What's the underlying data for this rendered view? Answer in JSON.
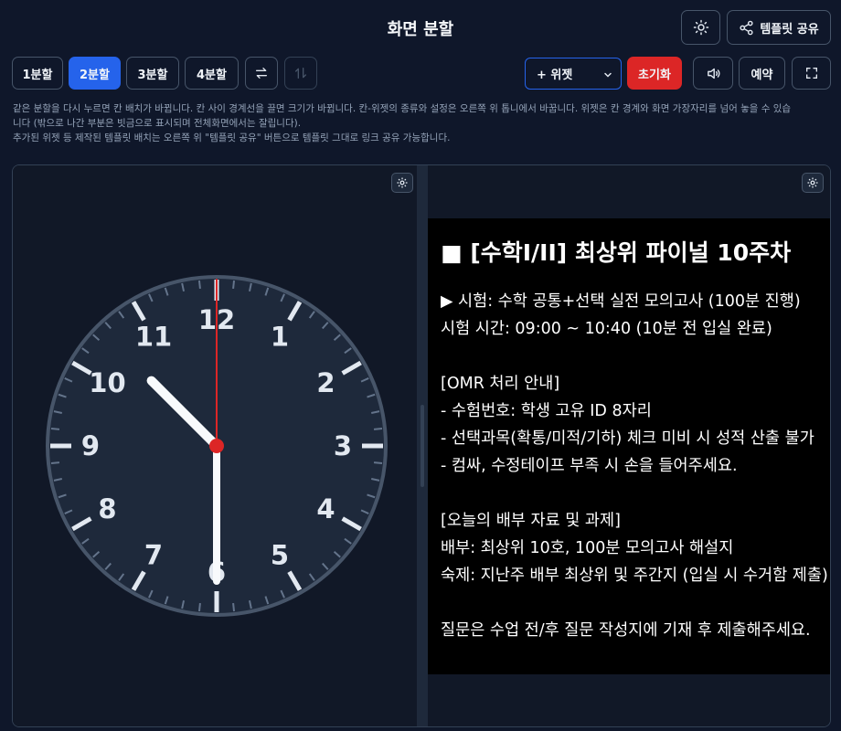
{
  "page": {
    "title": "화면 분할"
  },
  "header_actions": {
    "theme_icon": "sun-icon",
    "share_icon": "share-icon",
    "share_label": "템플릿 공유"
  },
  "split_buttons": [
    {
      "label": "1분할",
      "active": false
    },
    {
      "label": "2분할",
      "active": true
    },
    {
      "label": "3분할",
      "active": false
    },
    {
      "label": "4분할",
      "active": false
    }
  ],
  "toolbar": {
    "swap_icon": "swap-horizontal-icon",
    "sort_icon": "swap-vertical-icon",
    "widget_select": "+ 위젯",
    "reset_label": "초기화",
    "sound_icon": "speaker-icon",
    "reserve_label": "예약",
    "fullscreen_icon": "fullscreen-icon"
  },
  "help_text": {
    "line1": "같은 분할을 다시 누르면 칸 배치가 바뀝니다. 칸 사이 경계선을 끌면 크기가 바뀝니다. 칸-위젯의 종류와 설정은 오른쪽 위 톱니에서 바꿉니다. 위젯은 칸 경계와 화면 가장자리를 넘어 놓을 수 있습",
    "line2": "니다 (밖으로 나간 부분은 빗금으로 표시되며 전체화면에서는 잘립니다).",
    "line3": "추가된 위젯 등 제작된 템플릿 배치는 오른쪽 위 \"템플릿 공유\" 버튼으로 템플릿 그대로 링크 공유 가능합니다."
  },
  "clock_widget": {
    "numbers": [
      "12",
      "1",
      "2",
      "3",
      "4",
      "5",
      "6",
      "7",
      "8",
      "9",
      "10",
      "11"
    ],
    "time": {
      "hour": 10,
      "minute": 30,
      "second": 0
    },
    "second_hand_color": "#dc2626",
    "center_color": "#dc2626"
  },
  "notice_widget": {
    "heading": "■ [수학I/II] 최상위 파이널 10주차",
    "line1": "▶ 시험: 수학 공통+선택 실전 모의고사 (100분 진행)",
    "line2": "시험 시간: 09:00 ~ 10:40 (10분 전 입실 완료)",
    "omr_title": "[OMR 처리 안내]",
    "omr1": "- 수험번호: 학생 고유 ID 8자리",
    "omr2": "- 선택과목(확통/미적/기하) 체크 미비 시 성적 산출 불가",
    "omr3": "- 컴싸, 수정테이프 부족 시 손을 들어주세요.",
    "hw_title": "[오늘의 배부 자료 및 과제]",
    "hw1": "배부: 최상위 10호, 100분 모의고사 해설지",
    "hw2": "숙제: 지난주 배부 최상위 및 주간지 (입실 시 수거함 제출)",
    "footer": "질문은 수업 전/후 질문 작성지에 기재 후 제출해주세요."
  },
  "colors": {
    "accent": "#2563eb",
    "danger": "#dc2626",
    "background": "#0f172a"
  }
}
